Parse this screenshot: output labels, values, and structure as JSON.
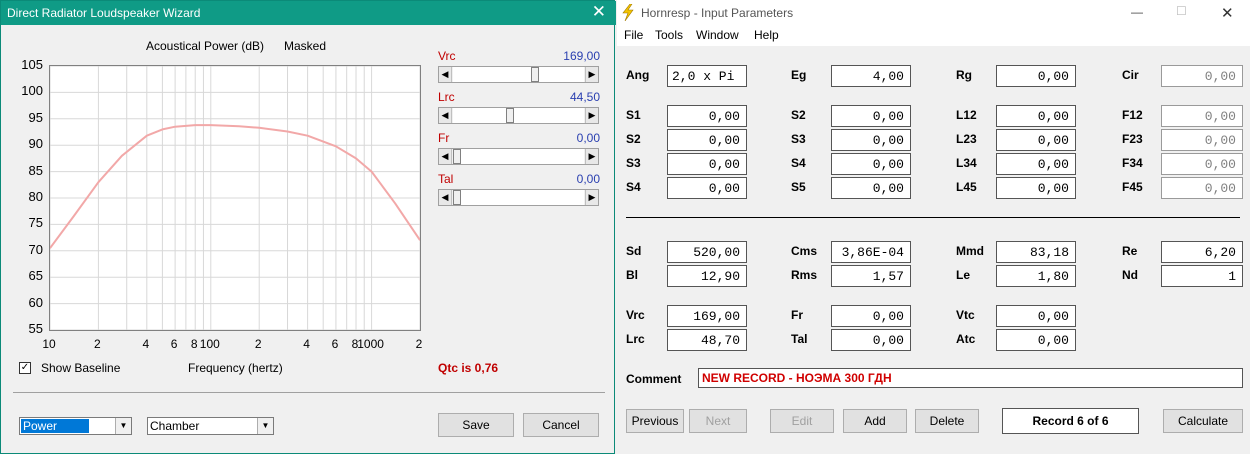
{
  "wizard": {
    "title": "Direct Radiator Loudspeaker Wizard",
    "plot_title": "Acoustical Power (dB)",
    "plot_mode": "Masked",
    "x_axis_label": "Frequency (hertz)",
    "sliders": [
      {
        "label": "Vrc",
        "value": "169,00",
        "position": 0.62
      },
      {
        "label": "Lrc",
        "value": "44,50",
        "position": 0.42
      },
      {
        "label": "Fr",
        "value": "0,00",
        "position": 0.0
      },
      {
        "label": "Tal",
        "value": "0,00",
        "position": 0.0
      }
    ],
    "show_baseline_label": "Show Baseline",
    "show_baseline_checked": true,
    "qtc_text": "Qtc is 0,76",
    "combo_power": "Power",
    "combo_chamber": "Chamber",
    "save_label": "Save",
    "cancel_label": "Cancel",
    "close_glyph": "✕"
  },
  "chart_data": {
    "type": "line",
    "title": "Acoustical Power (dB)",
    "subtitle": "Masked",
    "xlabel": "Frequency (hertz)",
    "ylabel": "",
    "x_scale": "log",
    "xlim": [
      10,
      2000
    ],
    "ylim": [
      55,
      105
    ],
    "yticks": [
      "105",
      "100",
      "95",
      "90",
      "85",
      "80",
      "75",
      "70",
      "65",
      "60",
      "55"
    ],
    "xticks": [
      {
        "v": 10,
        "label": "10"
      },
      {
        "v": 20,
        "label": "2"
      },
      {
        "v": 40,
        "label": "4"
      },
      {
        "v": 60,
        "label": "6"
      },
      {
        "v": 80,
        "label": "8"
      },
      {
        "v": 100,
        "label": "100"
      },
      {
        "v": 200,
        "label": "2"
      },
      {
        "v": 400,
        "label": "4"
      },
      {
        "v": 600,
        "label": "6"
      },
      {
        "v": 800,
        "label": "8"
      },
      {
        "v": 1000,
        "label": "1000"
      },
      {
        "v": 2000,
        "label": "2"
      }
    ],
    "grid": true,
    "series": [
      {
        "color": "#f2a8a8",
        "x": [
          10,
          14,
          20,
          28,
          40,
          50,
          60,
          80,
          100,
          150,
          200,
          300,
          400,
          600,
          800,
          1000,
          1400,
          2000
        ],
        "y": [
          70.5,
          76.5,
          83,
          88,
          91.8,
          93,
          93.5,
          93.8,
          93.8,
          93.6,
          93.3,
          92.6,
          91.8,
          89.8,
          87.5,
          85,
          79,
          72
        ]
      }
    ]
  },
  "hornresp": {
    "title": "Hornresp - Input Parameters",
    "menu": [
      "File",
      "Tools",
      "Window",
      "Help"
    ],
    "minimize_glyph": "—",
    "maximize_glyph": "☐",
    "close_glyph": "✕",
    "rows": [
      [
        {
          "label": "Ang",
          "value": "2,0 x Pi",
          "align": "left"
        },
        {
          "label": "Eg",
          "value": "4,00"
        },
        {
          "label": "Rg",
          "value": "0,00"
        },
        {
          "label": "Cir",
          "value": "0,00",
          "disabled": true
        }
      ],
      [
        {
          "label": "S1",
          "value": "0,00"
        },
        {
          "label": "S2",
          "value": "0,00"
        },
        {
          "label": "L12",
          "value": "0,00"
        },
        {
          "label": "F12",
          "value": "0,00",
          "disabled": true
        }
      ],
      [
        {
          "label": "S2",
          "value": "0,00"
        },
        {
          "label": "S3",
          "value": "0,00"
        },
        {
          "label": "L23",
          "value": "0,00"
        },
        {
          "label": "F23",
          "value": "0,00",
          "disabled": true
        }
      ],
      [
        {
          "label": "S3",
          "value": "0,00"
        },
        {
          "label": "S4",
          "value": "0,00"
        },
        {
          "label": "L34",
          "value": "0,00"
        },
        {
          "label": "F34",
          "value": "0,00",
          "disabled": true
        }
      ],
      [
        {
          "label": "S4",
          "value": "0,00"
        },
        {
          "label": "S5",
          "value": "0,00"
        },
        {
          "label": "L45",
          "value": "0,00"
        },
        {
          "label": "F45",
          "value": "0,00",
          "disabled": true
        }
      ],
      [
        {
          "label": "Sd",
          "value": "520,00"
        },
        {
          "label": "Cms",
          "value": "3,86E-04"
        },
        {
          "label": "Mmd",
          "value": "83,18"
        },
        {
          "label": "Re",
          "value": "6,20"
        }
      ],
      [
        {
          "label": "Bl",
          "value": "12,90"
        },
        {
          "label": "Rms",
          "value": "1,57"
        },
        {
          "label": "Le",
          "value": "1,80"
        },
        {
          "label": "Nd",
          "value": "1"
        }
      ],
      [
        {
          "label": "Vrc",
          "value": "169,00"
        },
        {
          "label": "Fr",
          "value": "0,00"
        },
        {
          "label": "Vtc",
          "value": "0,00"
        }
      ],
      [
        {
          "label": "Lrc",
          "value": "48,70"
        },
        {
          "label": "Tal",
          "value": "0,00"
        },
        {
          "label": "Atc",
          "value": "0,00"
        }
      ]
    ],
    "comment_label": "Comment",
    "comment_value": "NEW RECORD - НОЭМА 300 ГДН",
    "buttons": {
      "previous": "Previous",
      "next": "Next",
      "edit": "Edit",
      "add": "Add",
      "delete": "Delete",
      "record": "Record 6 of 6",
      "calculate": "Calculate"
    }
  }
}
